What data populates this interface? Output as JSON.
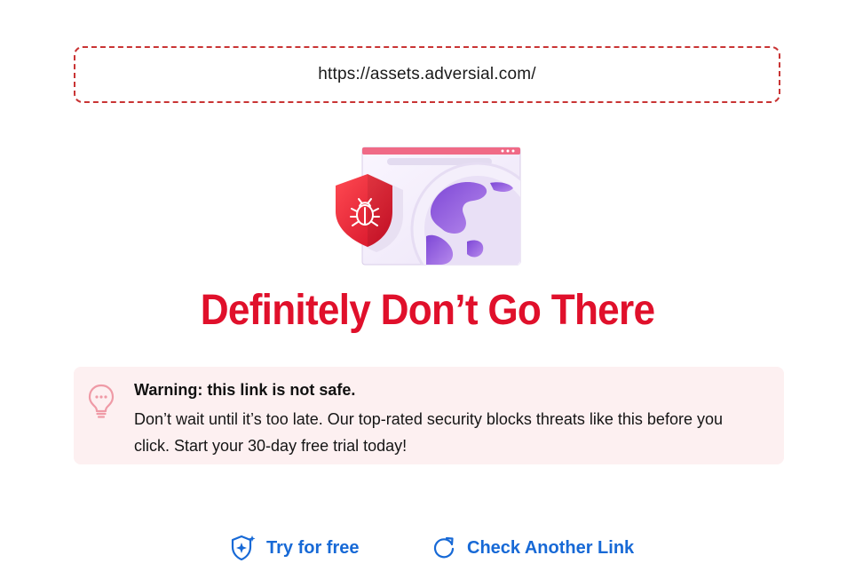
{
  "url_box": {
    "url": "https://assets.adversial.com/"
  },
  "headline": "Definitely Don’t Go There",
  "warning": {
    "title": "Warning: this link is not safe.",
    "text": "Don’t wait until it’s too late. Our top-rated security blocks threats like this before you click. Start your 30-day free trial today!"
  },
  "actions": {
    "try_label": "Try for free",
    "check_label": "Check Another Link"
  },
  "icons": {
    "illustration": "browser-globe-bug-shield-illustration",
    "warning": "lightbulb-icon",
    "try": "shield-sparkle-icon",
    "check": "refresh-icon"
  },
  "colors": {
    "accent_red": "#e0102b",
    "url_border": "#c93434",
    "warning_bg": "#fdf0f1",
    "link_blue": "#1769d6"
  }
}
